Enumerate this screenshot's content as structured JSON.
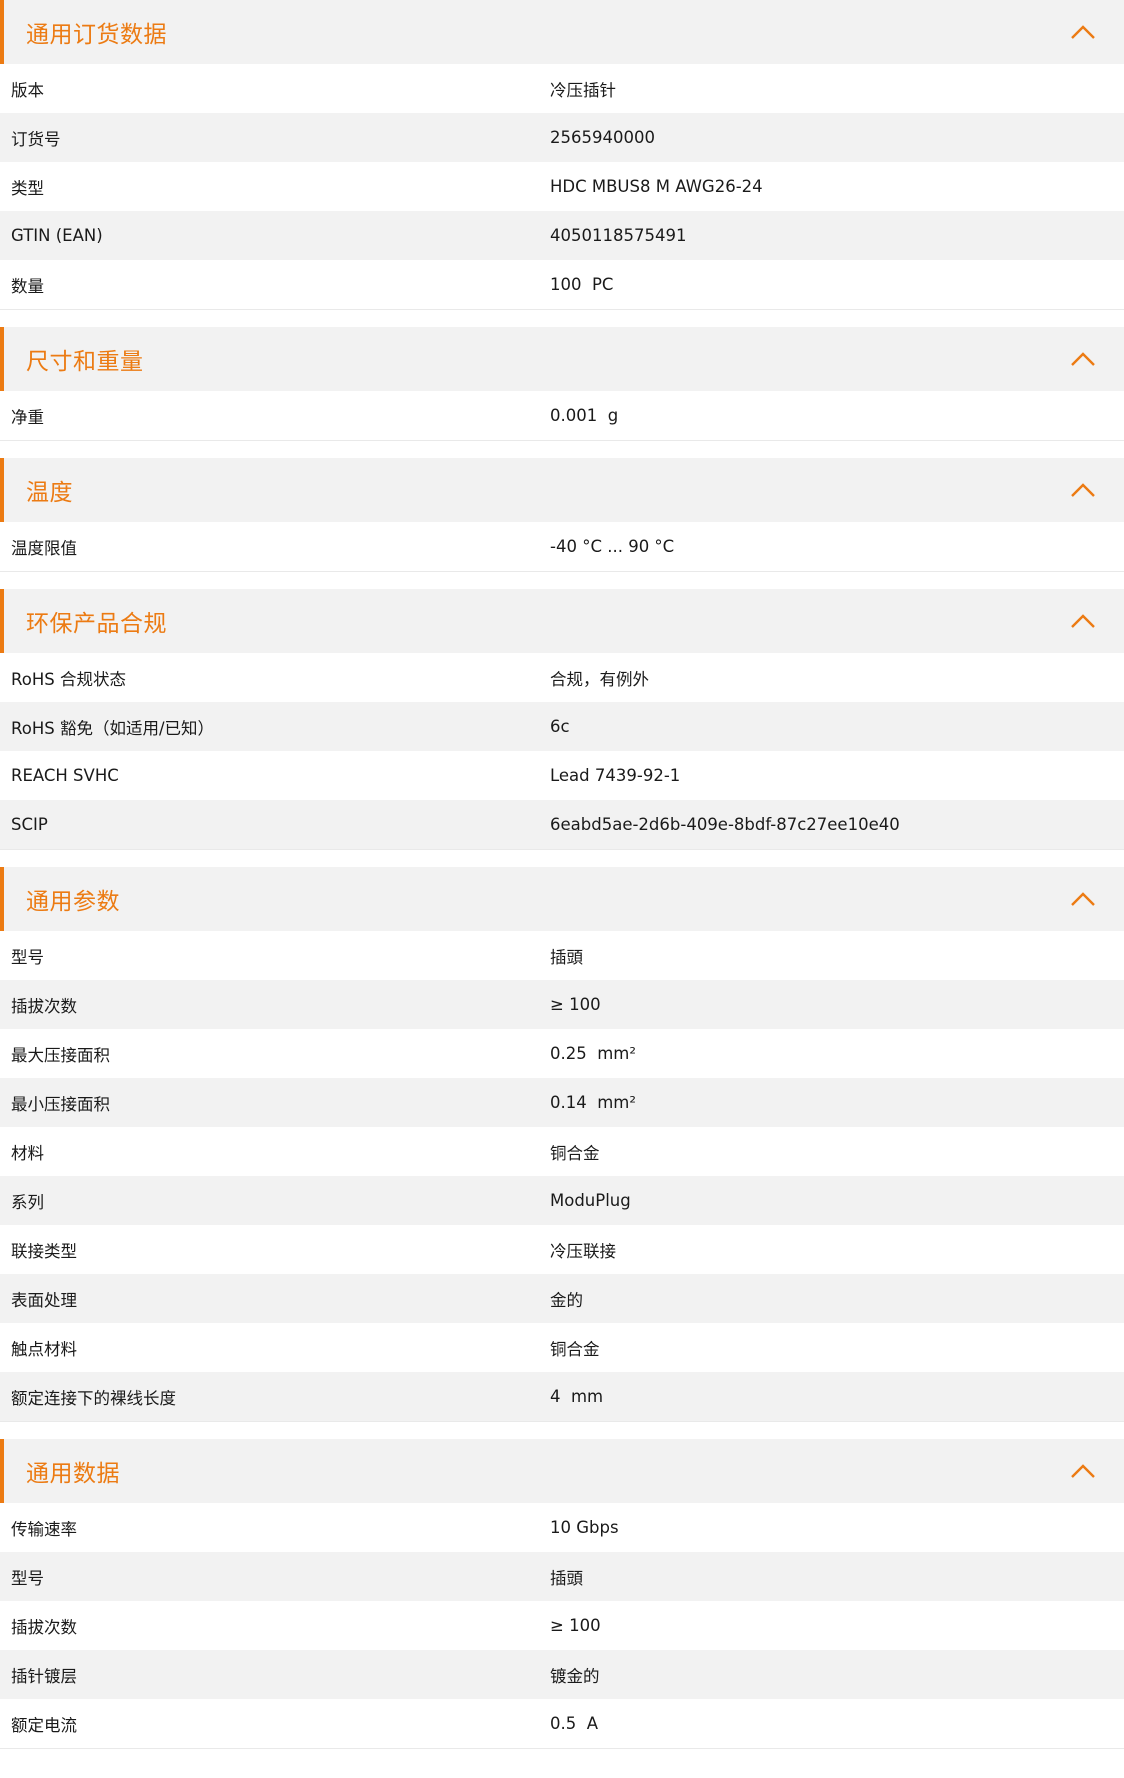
{
  "colors": {
    "accent": "#ec7b13",
    "header_bg": "#f2f2f2",
    "row_alt_bg": "#f2f2f2",
    "text": "#1a1a1a"
  },
  "sections": [
    {
      "title": "通用订货数据",
      "icon": "chevron-up-icon",
      "rows": [
        {
          "label": "版本",
          "value": "冷压插针"
        },
        {
          "label": "订货号",
          "value": "2565940000"
        },
        {
          "label": "类型",
          "value": "HDC MBUS8 M AWG26-24"
        },
        {
          "label": "GTIN (EAN)",
          "value": "4050118575491"
        },
        {
          "label": "数量",
          "value": "100  PC"
        }
      ]
    },
    {
      "title": "尺寸和重量",
      "icon": "chevron-up-icon",
      "rows": [
        {
          "label": "净重",
          "value": "0.001  g"
        }
      ]
    },
    {
      "title": "温度",
      "icon": "chevron-up-icon",
      "rows": [
        {
          "label": "温度限值",
          "value": "-40 °C ... 90 °C"
        }
      ]
    },
    {
      "title": "环保产品合规",
      "icon": "chevron-up-icon",
      "rows": [
        {
          "label": "RoHS 合规状态",
          "value": "合规，有例外"
        },
        {
          "label": "RoHS 豁免（如适用/已知）",
          "value": "6c"
        },
        {
          "label": "REACH SVHC",
          "value": "Lead 7439-92-1"
        },
        {
          "label": "SCIP",
          "value": "6eabd5ae-2d6b-409e-8bdf-87c27ee10e40"
        }
      ]
    },
    {
      "title": "通用参数",
      "icon": "chevron-up-icon",
      "rows": [
        {
          "label": "型号",
          "value": "插頭"
        },
        {
          "label": "插拔次数",
          "value": "≥ 100"
        },
        {
          "label": "最大压接面积",
          "value": "0.25  mm²"
        },
        {
          "label": "最小压接面积",
          "value": "0.14  mm²"
        },
        {
          "label": "材料",
          "value": "铜合金"
        },
        {
          "label": "系列",
          "value": "ModuPlug"
        },
        {
          "label": "联接类型",
          "value": "冷压联接"
        },
        {
          "label": "表面处理",
          "value": "金的"
        },
        {
          "label": "触点材料",
          "value": "铜合金"
        },
        {
          "label": "额定连接下的裸线长度",
          "value": "4  mm"
        }
      ]
    },
    {
      "title": "通用数据",
      "icon": "chevron-up-icon",
      "rows": [
        {
          "label": "传输速率",
          "value": "10 Gbps"
        },
        {
          "label": "型号",
          "value": "插頭"
        },
        {
          "label": "插拔次数",
          "value": "≥ 100"
        },
        {
          "label": "插针镀层",
          "value": "镀金的"
        },
        {
          "label": "额定电流",
          "value": "0.5  A"
        }
      ]
    }
  ]
}
